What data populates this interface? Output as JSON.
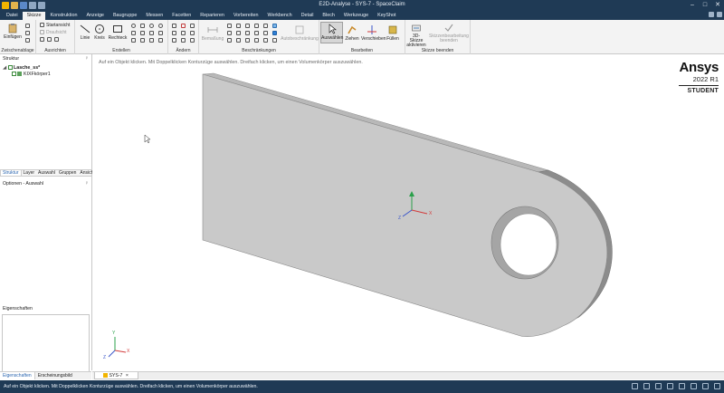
{
  "window": {
    "title": "E2D-Analyse - SYS-7 - SpaceClaim"
  },
  "menu_tabs": [
    "Datei",
    "Skizze",
    "Konstruktion",
    "Anzeige",
    "Baugruppe",
    "Messen",
    "Facetten",
    "Reparieren",
    "Vorbereiten",
    "Werkbench",
    "Detail",
    "Blech",
    "Werkzeuge",
    "KeyShot"
  ],
  "active_tab": "Skizze",
  "ribbon": {
    "groups": [
      {
        "label": "Zwischenablage"
      },
      {
        "label": "Ausrichten"
      },
      {
        "label": "Erstellen"
      },
      {
        "label": "Ändern"
      },
      {
        "label": "Beschränkungen"
      },
      {
        "label": "Bearbeiten"
      },
      {
        "label": "Skizze beenden"
      }
    ],
    "paste_label": "Einfügen",
    "view_items": [
      "Startansicht",
      "Draufsicht"
    ],
    "line_label": "Linie",
    "circle_label": "Kreis",
    "rect_label": "Rechteck",
    "dimension_label": "Bemaßung",
    "auto_constrain_label": "Autobeschränkung",
    "select_label": "Auswählen",
    "pull_label": "Ziehen",
    "move_label": "Verschieben",
    "fill_label": "Füllen",
    "sketch3d_label": "3D-Skizze aktivieren",
    "sketch_end_label": "Skizzenbearbeitung beenden"
  },
  "left_panel": {
    "structure_title": "Struktur",
    "tree": [
      {
        "label": "Lasche_ss*"
      },
      {
        "label": "KIXFkörper1"
      }
    ],
    "subtabs": [
      "Struktur",
      "Layer",
      "Auswahl",
      "Gruppen",
      "Ansichten"
    ],
    "options_title": "Optionen - Auswahl",
    "properties_title": "Eigenschaften",
    "bottom_tabs": [
      "Eigenschaften",
      "Erscheinungsbild"
    ]
  },
  "viewport": {
    "hint": "Auf ein Objekt klicken. Mit Doppelklicken Konturzüge auswählen. Dreifach klicken, um einen Volumenkörper auszuwählen.",
    "brand": "Ansys",
    "version": "2022 R1",
    "edition": "STUDENT",
    "axes": {
      "x": "X",
      "y": "Y",
      "z": "Z"
    }
  },
  "document_tab": "SYS-7",
  "status": {
    "text": "Auf ein Objekt klicken. Mit Doppelklicken Konturzüge auswählen. Dreifach klicken, um einen Volumenkörper auszuwählen."
  },
  "colors": {
    "chrome": "#1f3a55",
    "ribbon": "#f3f3f3",
    "part_face": "#c9c9c9",
    "part_side": "#a8a8a8",
    "axis_x": "#d23b3b",
    "axis_y": "#2aa04a",
    "axis_z": "#3a56c9"
  }
}
